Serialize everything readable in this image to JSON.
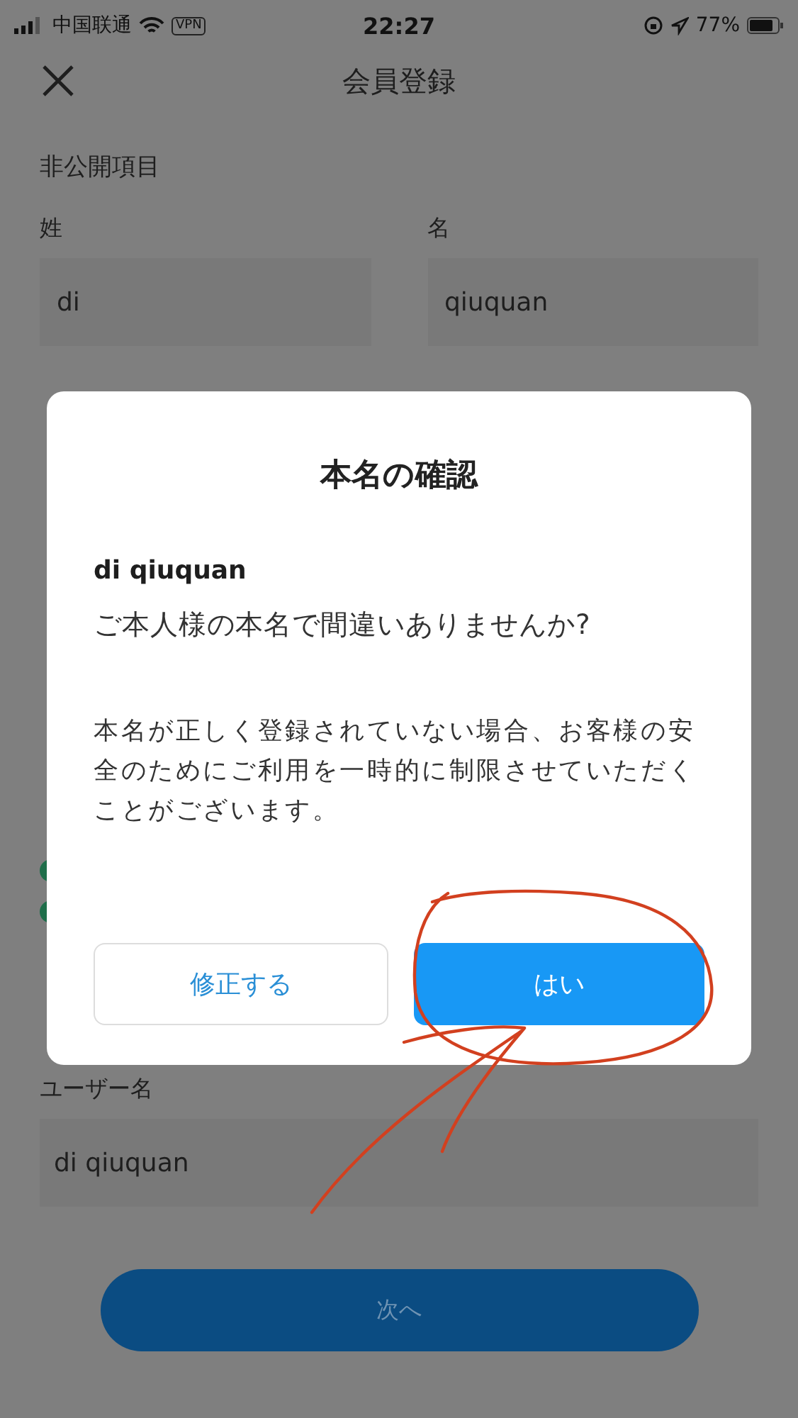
{
  "status_bar": {
    "carrier": "中国联通",
    "vpn": "VPN",
    "time": "22:27",
    "battery": "77%"
  },
  "nav": {
    "title": "会員登録"
  },
  "section_title": "非公開項目",
  "name_fields": [
    {
      "label": "姓",
      "value": "di"
    },
    {
      "label": "名",
      "value": "qiuquan"
    }
  ],
  "dialog": {
    "title": "本名の確認",
    "name": "di qiuquan",
    "question": "ご本人様の本名で間違いありませんか?",
    "note": "本名が正しく登録されていない場合、お客様の安全のためにご利用を一時的に制限させていただくことがございます。",
    "buttons": [
      {
        "label": "修正する",
        "kind": "secondary"
      },
      {
        "label": "はい",
        "kind": "primary"
      }
    ]
  },
  "username": {
    "label": "ユーザー名",
    "value": "di qiuquan"
  },
  "next_button": {
    "label": "次へ",
    "disabled": true
  }
}
